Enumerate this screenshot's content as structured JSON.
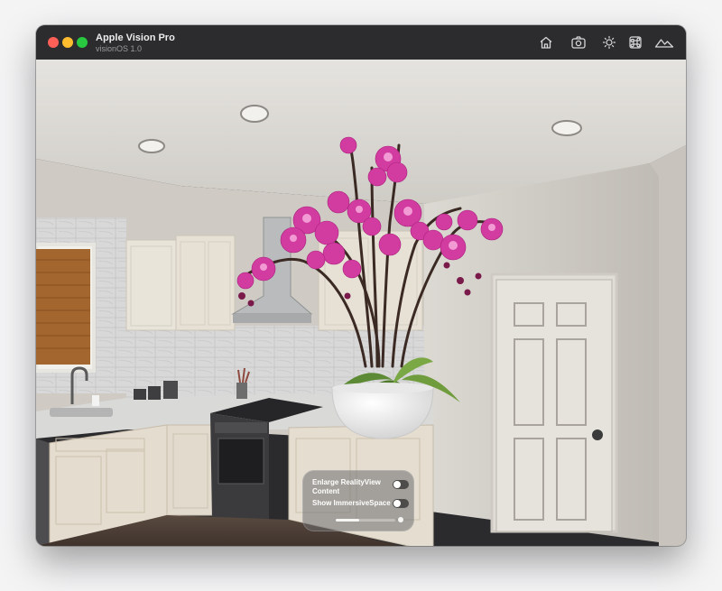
{
  "window": {
    "title": "Apple Vision Pro",
    "subtitle": "visionOS 1.0"
  },
  "titlebar_icons": [
    "home-icon",
    "camera-icon",
    "brightness-icon",
    "command-icon",
    "landscape-icon"
  ],
  "panel": {
    "toggles": [
      {
        "label": "Enlarge RealityView Content",
        "on": false
      },
      {
        "label": "Show ImmersiveSpace",
        "on": false
      }
    ],
    "slider_value": 0.4
  },
  "toolbar": {
    "tools": [
      "interact-icon",
      "look-icon",
      "pan-icon",
      "orbit-icon",
      "zoom-icon"
    ],
    "selected": "interact-icon",
    "record": "record-video-icon"
  },
  "colors": {
    "titlebar": "#2c2c2f",
    "accent": "#3c8cf0",
    "orchid": "#d23ca0"
  }
}
